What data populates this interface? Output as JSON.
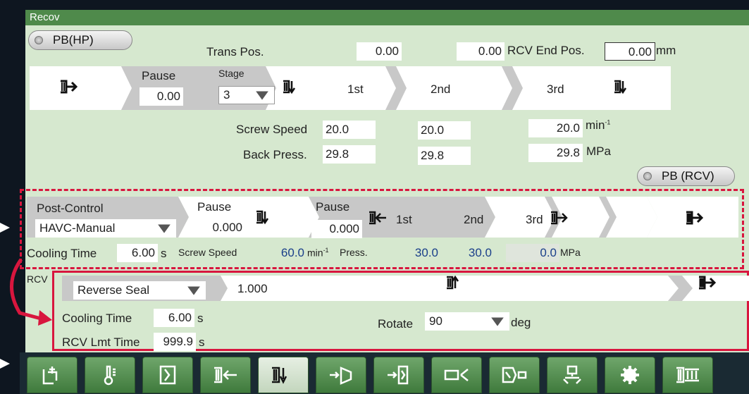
{
  "title": "Recov",
  "pb_hp": "PB(HP)",
  "pb_rcv": "PB (RCV)",
  "trans_pos": {
    "label": "Trans Pos.",
    "v1": "0.00",
    "v2": "0.00"
  },
  "rcv_end_pos": {
    "label": "RCV End Pos.",
    "value": "0.00",
    "unit": "mm"
  },
  "recov": {
    "pause_label": "Pause",
    "pause_value": "0.00",
    "stage_label": "Stage",
    "stage_value": "3",
    "steps": [
      "1st",
      "2nd",
      "3rd"
    ],
    "screw_speed_label": "Screw Speed",
    "screw_speed": [
      "20.0",
      "20.0",
      "20.0"
    ],
    "screw_speed_unit": "min",
    "screw_speed_sup": "-1",
    "back_press_label": "Back Press.",
    "back_press": [
      "29.8",
      "29.8",
      "29.8"
    ],
    "back_press_unit": "MPa"
  },
  "post": {
    "label": "Post-Control",
    "mode": "HAVC-Manual",
    "pause1_label": "Pause",
    "pause1": "0.000",
    "pause2_label": "Pause",
    "pause2": "0.000",
    "step1": "1st",
    "step2": "2nd",
    "step3": "3rd",
    "cooling_label": "Cooling Time",
    "cooling": "6.00",
    "cooling_unit": "s",
    "screw_speed_label": "Screw Speed",
    "screw_speed": "60.0",
    "screw_unit": "min",
    "screw_sup": "-1",
    "press_label": "Press.",
    "press": [
      "30.0",
      "30.0",
      "0.0"
    ],
    "press_unit": "MPa"
  },
  "rcv": {
    "label": "RCV",
    "mode": "Reverse Seal",
    "value": "1.000",
    "cooling_label": "Cooling Time",
    "cooling": "6.00",
    "cooling_unit": "s",
    "rotate_label": "Rotate",
    "rotate": "90",
    "rotate_unit": "deg",
    "lmt_label": "RCV Lmt Time",
    "lmt": "999.9",
    "lmt_unit": "s"
  },
  "toolbar": [
    "mold-icon",
    "thermometer-icon",
    "clamp-icon",
    "inject-icon",
    "recov-icon",
    "eject-icon",
    "core-icon",
    "nozzle-icon",
    "robot-icon",
    "hopper-icon",
    "settings-icon",
    "screw-icon"
  ],
  "colors": {
    "panel": "#d6e8cf",
    "title": "#4f8a4b",
    "accent": "#d8163e",
    "blue_value": "#1a3f8a"
  }
}
